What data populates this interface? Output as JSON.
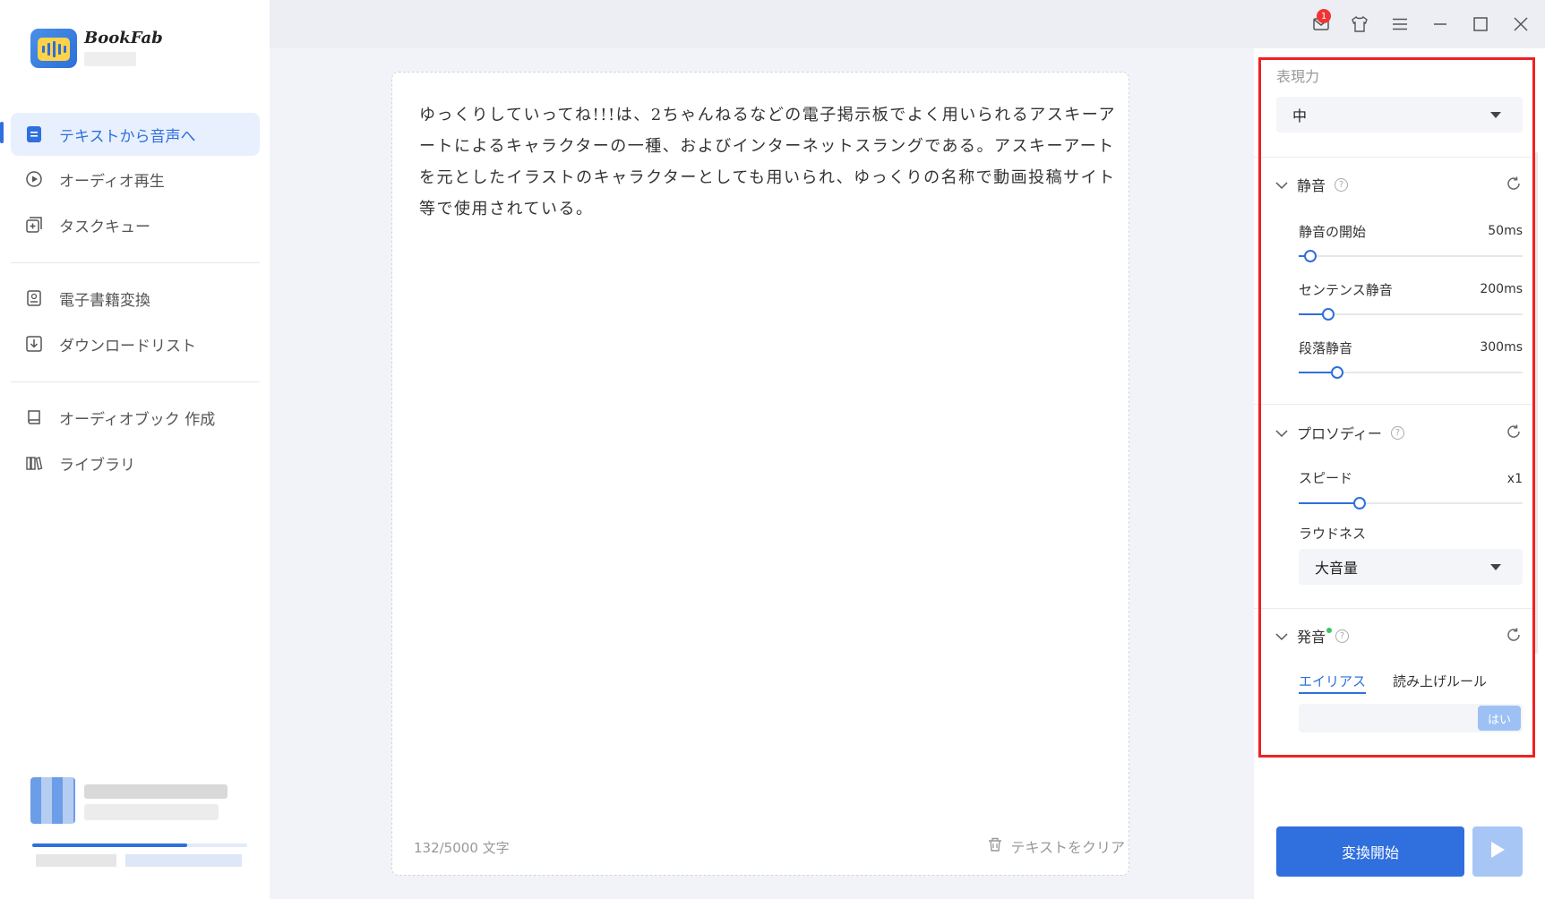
{
  "app": {
    "name": "BookFab",
    "mail_badge": "1"
  },
  "sidebar": {
    "items": [
      {
        "label": "テキストから音声へ",
        "icon": "document-icon",
        "active": true
      },
      {
        "label": "オーディオ再生",
        "icon": "play-circle-icon",
        "active": false
      },
      {
        "label": "タスクキュー",
        "icon": "task-queue-icon",
        "active": false
      },
      {
        "label": "電子書籍変換",
        "icon": "ebook-icon",
        "active": false
      },
      {
        "label": "ダウンロードリスト",
        "icon": "download-icon",
        "active": false
      },
      {
        "label": "オーディオブック 作成",
        "icon": "book-icon",
        "active": false
      },
      {
        "label": "ライブラリ",
        "icon": "library-icon",
        "active": false
      }
    ],
    "progress_fraction": 0.72
  },
  "editor": {
    "text": "ゆっくりしていってね!!!は、2ちゃんねるなどの電子掲示板でよく用いられるアスキーアートによるキャラクターの一種、およびインターネットスラングである。アスキーアートを元としたイラストのキャラクターとしても用いられ、ゆっくりの名称で動画投稿サイト等で使用されている。",
    "char_count": "132/5000 文字",
    "clear_label": "テキストをクリア"
  },
  "settings": {
    "expressiveness": {
      "label": "表現力",
      "value": "中"
    },
    "silence": {
      "title": "静音",
      "items": [
        {
          "label": "静音の開始",
          "value": "50ms",
          "fraction": 0.05
        },
        {
          "label": "センテンス静音",
          "value": "200ms",
          "fraction": 0.13
        },
        {
          "label": "段落静音",
          "value": "300ms",
          "fraction": 0.17
        }
      ]
    },
    "prosody": {
      "title": "プロソディー",
      "speed": {
        "label": "スピード",
        "value": "x1",
        "fraction": 0.27
      },
      "loudness": {
        "label": "ラウドネス",
        "value": "大音量"
      }
    },
    "pronunciation": {
      "title": "発音",
      "tabs": [
        "エイリアス",
        "読み上げルール"
      ],
      "button": "はい"
    }
  },
  "actions": {
    "start": "変換開始"
  }
}
